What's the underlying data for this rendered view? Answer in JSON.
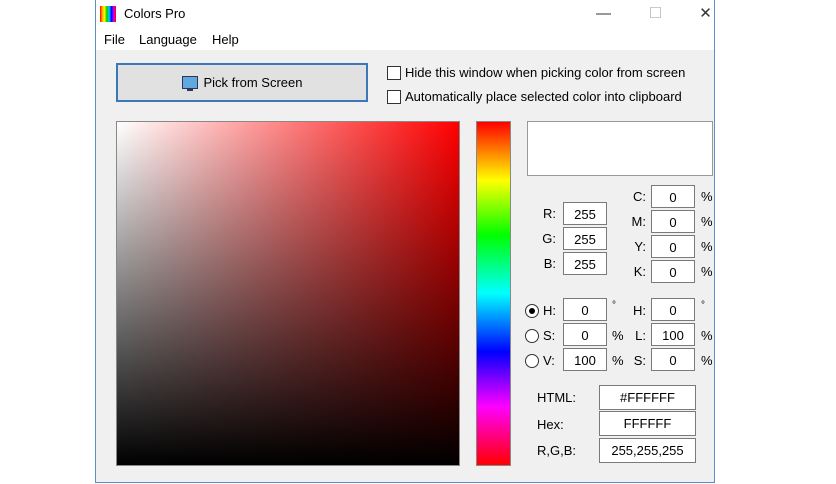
{
  "window": {
    "title": "Colors Pro",
    "minimize": "—",
    "maximize": "☐",
    "close": "✕"
  },
  "menu": [
    "File",
    "Language",
    "Help"
  ],
  "pick_button": "Pick from Screen",
  "options": [
    "Hide this window when picking color from screen",
    "Automatically place selected color into clipboard"
  ],
  "rgb": [
    {
      "label": "R:",
      "value": "255"
    },
    {
      "label": "G:",
      "value": "255"
    },
    {
      "label": "B:",
      "value": "255"
    }
  ],
  "cmyk": [
    {
      "label": "C:",
      "value": "0",
      "unit": "%"
    },
    {
      "label": "M:",
      "value": "0",
      "unit": "%"
    },
    {
      "label": "Y:",
      "value": "0",
      "unit": "%"
    },
    {
      "label": "K:",
      "value": "0",
      "unit": "%"
    }
  ],
  "hsv": [
    {
      "label": "H:",
      "value": "0",
      "unit": "°",
      "selected": true
    },
    {
      "label": "S:",
      "value": "0",
      "unit": "%"
    },
    {
      "label": "V:",
      "value": "100",
      "unit": "%"
    }
  ],
  "hsl": [
    {
      "label": "H:",
      "value": "0",
      "unit": "°"
    },
    {
      "label": "L:",
      "value": "100",
      "unit": "%"
    },
    {
      "label": "S:",
      "value": "0",
      "unit": "%"
    }
  ],
  "outputs": [
    {
      "label": "HTML:",
      "value": "#FFFFFF"
    },
    {
      "label": "Hex:",
      "value": "FFFFFF"
    },
    {
      "label": "R,G,B:",
      "value": "255,255,255"
    }
  ],
  "current_color": "#FFFFFF"
}
